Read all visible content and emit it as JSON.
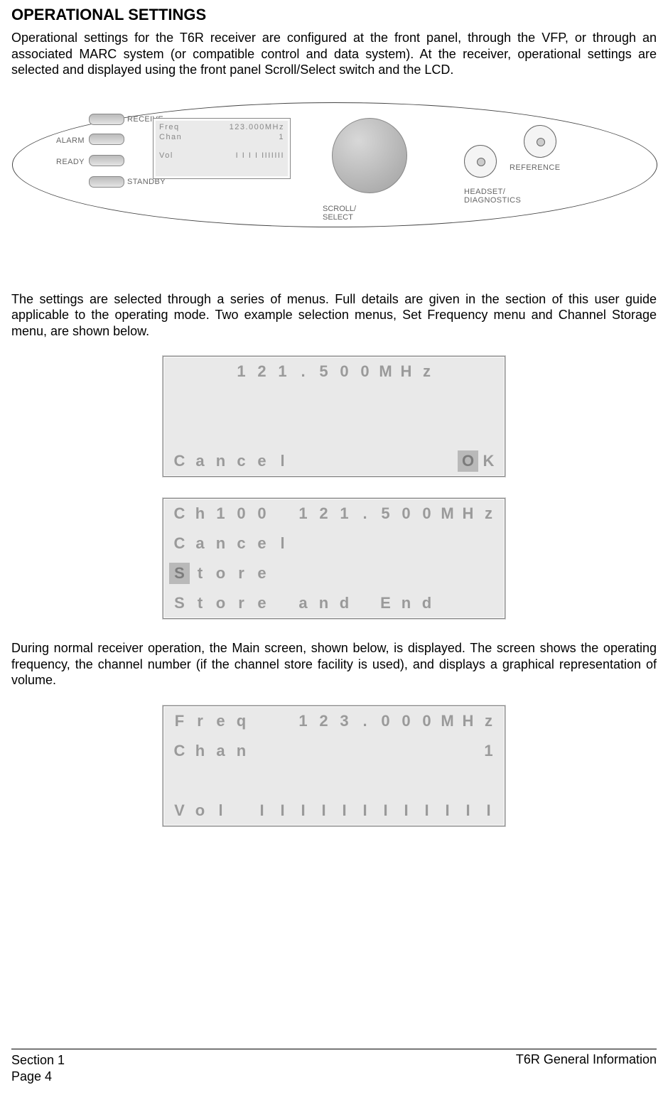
{
  "heading": "OPERATIONAL SETTINGS",
  "paragraphs": {
    "p1": "Operational settings for the T6R receiver are configured at the front panel, through the VFP, or through an associated MARC system (or compatible control and data system). At the receiver, operational settings are selected and displayed using the front panel Scroll/Select switch and the LCD.",
    "p2": "The settings are selected through a series of menus. Full details are given in the section of this user guide applicable to the operating mode. Two example selection menus, Set Frequency menu and Channel Storage menu, are shown below.",
    "p3": "During normal receiver operation, the Main screen, shown below, is displayed. The screen shows the operating frequency, the channel number (if the channel store facility is used),  and displays a graphical representation of volume."
  },
  "panel": {
    "leds": {
      "receive": "RECEIVE",
      "alarm": "ALARM",
      "ready": "READY",
      "standby": "STANDBY"
    },
    "lcd": {
      "row1a": "Freq",
      "row1b": "123.000MHz",
      "row2a": "Chan",
      "row2b": "1",
      "row4a": "Vol",
      "row4b": "I I I I IIIIIII"
    },
    "knob_label": "SCROLL/\nSELECT",
    "jacks": {
      "headset": "HEADSET/\nDIAGNOSTICS",
      "reference": "REFERENCE"
    }
  },
  "lcd1": {
    "row1": [
      "",
      "",
      "",
      "1",
      "2",
      "1",
      ".",
      "5",
      "0",
      "0",
      "M",
      "H",
      "z",
      "",
      "",
      ""
    ],
    "row4": [
      "C",
      "a",
      "n",
      "c",
      "e",
      "l",
      "",
      "",
      "",
      "",
      "",
      "",
      "",
      "",
      "O",
      "K"
    ],
    "highlight_index": 14
  },
  "lcd2": {
    "row1": [
      "C",
      "h",
      "1",
      "0",
      "0",
      "",
      "1",
      "2",
      "1",
      ".",
      "5",
      "0",
      "0",
      "M",
      "H",
      "z"
    ],
    "row2": [
      "C",
      "a",
      "n",
      "c",
      "e",
      "l",
      "",
      "",
      "",
      "",
      "",
      "",
      "",
      "",
      "",
      ""
    ],
    "row3": [
      "S",
      "t",
      "o",
      "r",
      "e",
      "",
      "",
      "",
      "",
      "",
      "",
      "",
      "",
      "",
      "",
      ""
    ],
    "row4": [
      "S",
      "t",
      "o",
      "r",
      "e",
      "",
      "a",
      "n",
      "d",
      "",
      "E",
      "n",
      "d",
      "",
      "",
      ""
    ],
    "highlight_row": 3,
    "highlight_index": 0
  },
  "lcd3": {
    "row1": [
      "F",
      "r",
      "e",
      "q",
      "",
      "",
      "1",
      "2",
      "3",
      ".",
      "0",
      "0",
      "0",
      "M",
      "H",
      "z"
    ],
    "row2": [
      "C",
      "h",
      "a",
      "n",
      "",
      "",
      "",
      "",
      "",
      "",
      "",
      "",
      "",
      "",
      "",
      "1"
    ],
    "row4": [
      "V",
      "o",
      "l",
      "",
      "I",
      "I",
      "I",
      "I",
      "I",
      "I",
      "I",
      "I",
      "I",
      "I",
      "I",
      "I"
    ]
  },
  "footer": {
    "section_line1": "Section 1",
    "section_line2": "Page 4",
    "doc_title": "T6R General Information"
  }
}
